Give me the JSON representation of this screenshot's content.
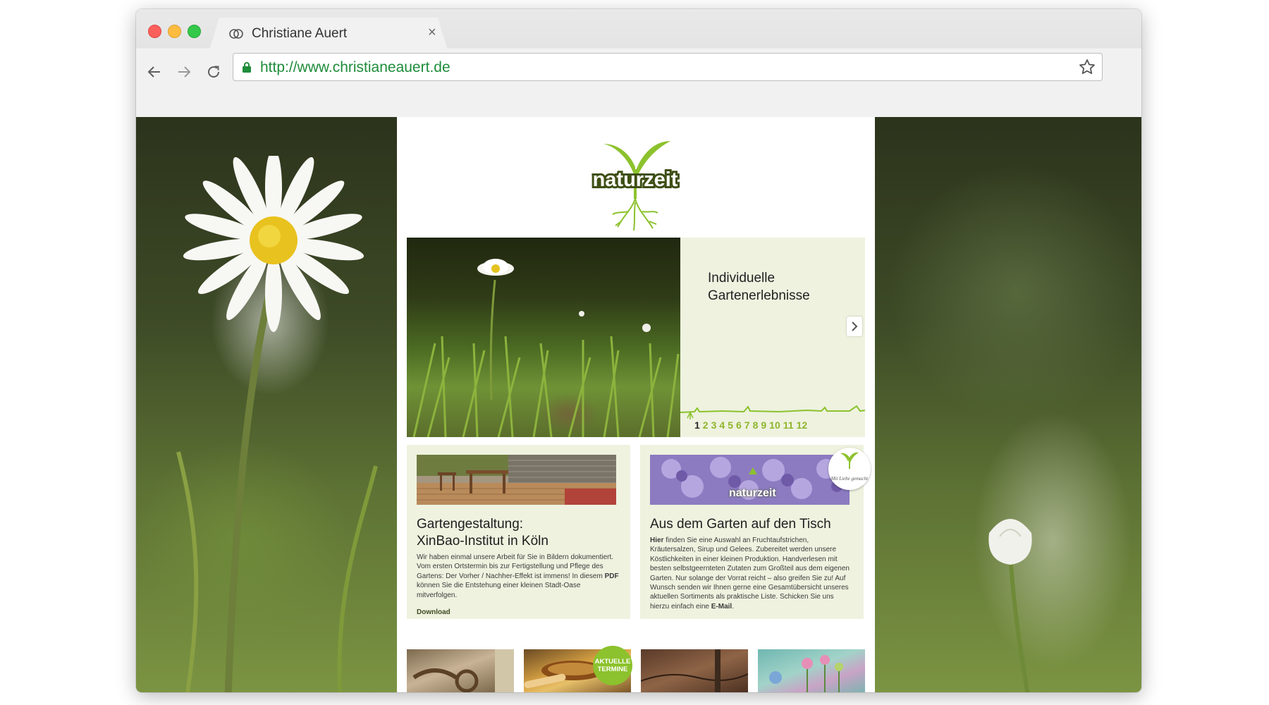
{
  "browser": {
    "tab_title": "Christiane Auert",
    "tab_close": "×",
    "url": "http://www.christianeauert.de",
    "icons": [
      "back-arrow-icon",
      "forward-arrow-icon",
      "reload-icon",
      "lock-icon",
      "star-icon"
    ]
  },
  "site": {
    "logo_text": "naturzeit",
    "hero": {
      "title_line1": "Individuelle",
      "title_line2": "Gartenerlebnisse",
      "pages": [
        "1",
        "2",
        "3",
        "4",
        "5",
        "6",
        "7",
        "8",
        "9",
        "10",
        "11",
        "12"
      ],
      "active_page": "1"
    },
    "card_left": {
      "title_line1": "Gartengestaltung:",
      "title_line2": "XinBao-Institut in Köln",
      "text_part1": "Wir haben einmal unsere Arbeit für Sie in Bildern dokumentiert. Vom ersten Ortstermin bis zur Fertigstellung und Pflege des Gartens: Der Vorher / Nachher-Effekt ist immens! In diesem ",
      "text_bold": "PDF",
      "text_part2": " können Sie die Entstehung einer kleinen Stadt-Oase mitverfolgen.",
      "download_label": "Download"
    },
    "card_right": {
      "image_label": "naturzeit",
      "badge_text": "Mit Liebe gemacht",
      "title": "Aus dem Garten auf den Tisch",
      "text_bold_start": "Hier",
      "text_part1": " finden Sie eine Auswahl an Fruchtaufstrichen, Kräutersalzen, Sirup und Gelees. Zubereitet werden unsere Köstlichkeiten in einer kleinen Produktion. Handverlesen mit besten selbstgeernteten Zutaten zum Großteil aus dem eigenen Garten. Nur solange der Vorrat reicht – also greifen Sie zu! Auf Wunsch senden wir Ihnen gerne eine Gesamtübersicht unseres aktuellen Sortiments als praktische Liste. Schicken Sie uns hierzu einfach eine ",
      "text_bold_end": "E-Mail",
      "text_end": "."
    },
    "badge_termine_line1": "AKTUELLE",
    "badge_termine_line2": "TERMINE"
  },
  "colors": {
    "accent_green": "#8fb52c",
    "panel_bg": "#eef2df",
    "url_green": "#1e8c3a"
  }
}
